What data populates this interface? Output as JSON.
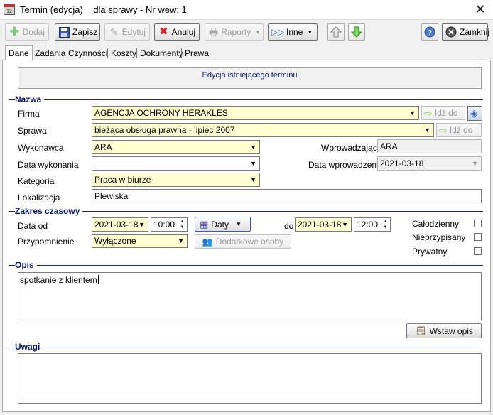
{
  "window": {
    "title": "Termin (edycja)",
    "subtitle": "dla sprawy - Nr wew: 1",
    "close_glyph": "✕"
  },
  "toolbar": {
    "add": "Dodaj",
    "save": "Zapisz",
    "edit": "Edytuj",
    "cancel": "Anuluj",
    "reports": "Raporty",
    "other": "Inne",
    "close": "Zamknij"
  },
  "tabs": [
    "Dane",
    "Zadania",
    "Czynności",
    "Koszty",
    "Dokumenty",
    "Prawa"
  ],
  "info_text": "Edycja istniejącego terminu",
  "sections": {
    "nazwa": "Nazwa",
    "zakres": "Zakres czasowy",
    "opis": "Opis",
    "uwagi": "Uwagi"
  },
  "nazwa": {
    "firma_label": "Firma",
    "firma_value": "AGENCJA OCHRONY HERAKLES",
    "sprawa_label": "Sprawa",
    "sprawa_value": "bieżąca obsługa prawna - lipiec 2007",
    "go_label": "Idź do",
    "wykonawca_label": "Wykonawca",
    "wykonawca_value": "ARA",
    "data_wykonania_label": "Data wykonania",
    "data_wykonania_value": "",
    "kategoria_label": "Kategoria",
    "kategoria_value": "Praca w biurze",
    "lokalizacja_label": "Lokalizacja",
    "lokalizacja_value": "Plewiska",
    "wprowadzajacy_label": "Wprowadzający",
    "wprowadzajacy_value": "ARA",
    "data_wprowadzenia_label": "Data wprowadzenia",
    "data_wprowadzenia_value": "2021-03-18"
  },
  "zakres": {
    "data_od_label": "Data od",
    "date_from": "2021-03-18",
    "time_from": "10:00",
    "daty_button": "Daty",
    "do_label": "do",
    "date_to": "2021-03-18",
    "time_to": "12:00",
    "przypomnienie_label": "Przypomnienie",
    "przypomnienie_value": "Wyłączone",
    "dodatkowe_osoby": "Dodatkowe osoby",
    "calodzienny": "Całodzienny",
    "nieprzypisany": "Nieprzypisany",
    "prywatny": "Prywatny"
  },
  "opis": {
    "text": "spotkanie z klientem",
    "wstaw_button": "Wstaw opis"
  },
  "uwagi": {
    "text": ""
  }
}
